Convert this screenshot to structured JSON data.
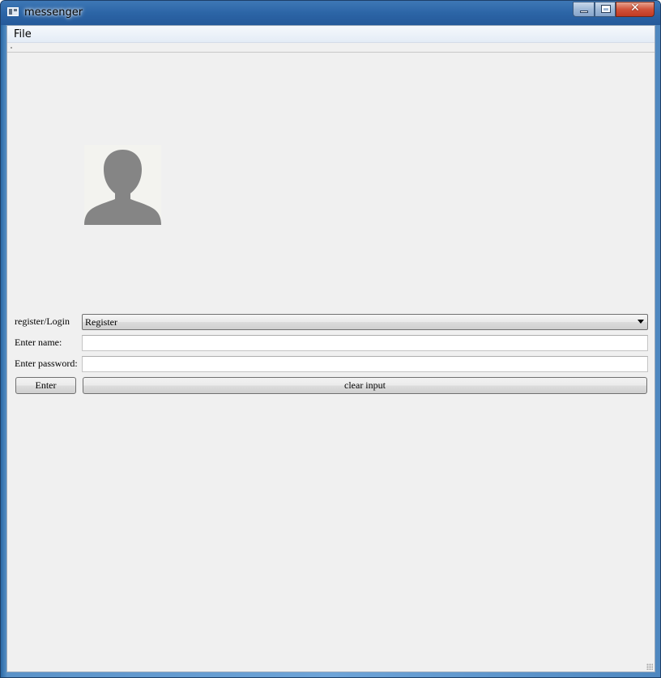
{
  "window": {
    "title": "messenger",
    "icon": "app-window-icon"
  },
  "controls": {
    "minimize_icon": "minimize-icon",
    "maximize_icon": "maximize-icon",
    "close_glyph": "✕"
  },
  "menu": {
    "items": [
      "File"
    ]
  },
  "avatar": {
    "icon": "user-silhouette-icon",
    "background": "#f3f3ef",
    "fill": "#858585"
  },
  "form": {
    "mode_label": "register/Login",
    "mode_selected": "Register",
    "name_label": "Enter name:",
    "name_value": "",
    "password_label": "Enter password:",
    "password_value": "",
    "enter_button": "Enter",
    "clear_button": "clear input"
  }
}
